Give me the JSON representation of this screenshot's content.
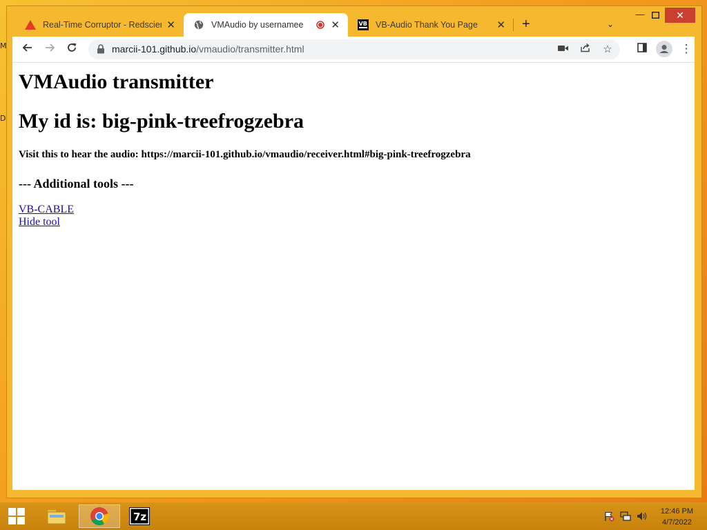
{
  "desktop": {
    "letters": [
      "M",
      "D"
    ]
  },
  "window": {
    "tabs": [
      {
        "title": "Real-Time Corruptor - Redscienti",
        "icon": "warning-triangle-icon"
      },
      {
        "title": "VMAudio by usernamee",
        "icon": "globe-icon",
        "recording": true
      },
      {
        "title": "VB-Audio Thank You Page",
        "icon": "vb-audio-logo-icon"
      }
    ],
    "new_tab": "+",
    "controls": {
      "minimize": "🗕",
      "maximize": "🗖",
      "close": "✕"
    }
  },
  "toolbar": {
    "url_host": "marcii-101.github.io",
    "url_path": "/vmaudio/transmitter.html"
  },
  "page": {
    "title": "VMAudio transmitter",
    "id_line": "My id is: big-pink-treefrogzebra",
    "visit_line": "Visit this to hear the audio: https://marcii-101.github.io/vmaudio/receiver.html#big-pink-treefrogzebra",
    "tools_heading": "--- Additional tools ---",
    "links": [
      "VB-CABLE",
      "Hide tool"
    ]
  },
  "taskbar": {
    "clock_time": "12:46 PM",
    "clock_date": "4/7/2022",
    "accent": "#c7820c"
  }
}
